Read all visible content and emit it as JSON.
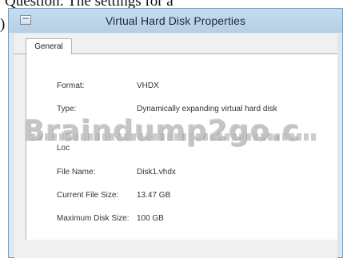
{
  "page": {
    "top_text": "Question: The settings for a",
    "side_char": ")"
  },
  "window": {
    "title": "Virtual Hard Disk Properties",
    "tab": "General"
  },
  "properties": {
    "format_label": "Format:",
    "format_value": "VHDX",
    "type_label": "Type:",
    "type_value": "Dynamically expanding virtual hard disk",
    "location_label": "Loc",
    "file_name_label": "File Name:",
    "file_name_value": "Disk1.vhdx",
    "current_size_label": "Current File Size:",
    "current_size_value": "13.47 GB",
    "max_size_label": "Maximum Disk Size:",
    "max_size_value": "100 GB"
  },
  "watermark": "Braindump2go.c"
}
